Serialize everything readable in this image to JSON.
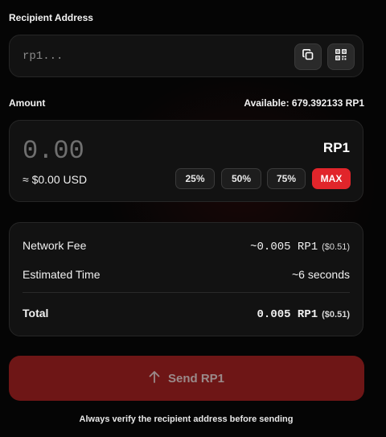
{
  "recipient": {
    "label": "Recipient Address",
    "placeholder": "rp1...",
    "copy_icon": "copy-icon",
    "qr_icon": "qr-code-icon"
  },
  "amount": {
    "label": "Amount",
    "available": "Available: 679.392133 RP1",
    "placeholder": "0.00",
    "token": "RP1",
    "usd": "≈ $0.00 USD",
    "quick": [
      "25%",
      "50%",
      "75%",
      "MAX"
    ]
  },
  "fees": {
    "network_fee_label": "Network Fee",
    "network_fee_value": "~0.005 RP1",
    "network_fee_usd": "($0.51)",
    "time_label": "Estimated Time",
    "time_value": "~6 seconds",
    "total_label": "Total",
    "total_value": "0.005 RP1",
    "total_usd": "($0.51)"
  },
  "send": {
    "label": "Send RP1",
    "icon": "arrow-up-icon"
  },
  "footer_hint": "Always verify the recipient address before sending",
  "colors": {
    "background": "#050505",
    "card": "#121212",
    "accent": "#e1252b",
    "send_disabled": "#6e1616"
  }
}
